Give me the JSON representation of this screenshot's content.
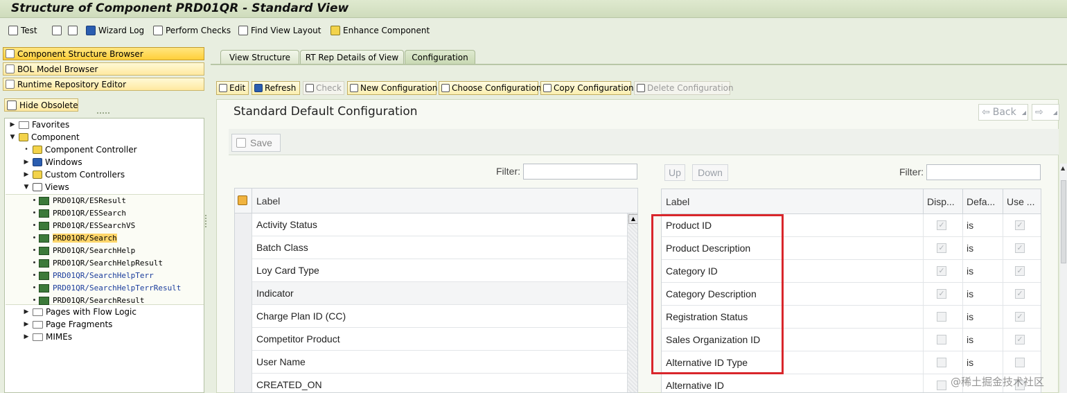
{
  "title": "Structure of Component PRD01QR - Standard View",
  "app_toolbar": {
    "test": "Test",
    "wizard_log": "Wizard Log",
    "perform_checks": "Perform Checks",
    "find_view_layout": "Find View Layout",
    "enhance_component": "Enhance Component"
  },
  "left": {
    "nav_buttons": [
      "Component Structure Browser",
      "BOL Model Browser",
      "Runtime Repository Editor"
    ],
    "hide_obsolete": "Hide Obsolete",
    "tree": {
      "favorites": "Favorites",
      "component": "Component",
      "component_controller": "Component Controller",
      "windows": "Windows",
      "custom_controllers": "Custom Controllers",
      "views": "Views",
      "view_items": [
        "PRD01QR/ESResult",
        "PRD01QR/ESSearch",
        "PRD01QR/ESSearchVS",
        "PRD01QR/Search",
        "PRD01QR/SearchHelp",
        "PRD01QR/SearchHelpResult",
        "PRD01QR/SearchHelpTerr",
        "PRD01QR/SearchHelpTerrResult",
        "PRD01QR/SearchResult"
      ],
      "pages_with_flow_logic": "Pages with Flow Logic",
      "page_fragments": "Page Fragments",
      "mimes": "MIMEs"
    }
  },
  "tabs": [
    "View Structure",
    "RT Rep Details of View",
    "Configuration"
  ],
  "config_toolbar": [
    "Edit",
    "Refresh",
    "Check",
    "New Configuration",
    "Choose Configuration",
    "Copy Configuration",
    "Delete Configuration"
  ],
  "config": {
    "title": "Standard Default Configuration",
    "back": "Back",
    "save": "Save",
    "filter_label": "Filter:",
    "up": "Up",
    "down": "Down",
    "left_table": {
      "header": "Label",
      "rows": [
        "Activity Status",
        "Batch Class",
        "Loy Card Type",
        "Indicator",
        "Charge Plan ID (CC)",
        "Competitor Product",
        "User Name",
        "CREATED_ON"
      ]
    },
    "right_table": {
      "headers": [
        "Label",
        "Disp...",
        "Defa...",
        "Use ..."
      ],
      "rows": [
        {
          "label": "Product ID",
          "disp": true,
          "def": "is",
          "use": true
        },
        {
          "label": "Product Description",
          "disp": true,
          "def": "is",
          "use": true
        },
        {
          "label": "Category ID",
          "disp": true,
          "def": "is",
          "use": true
        },
        {
          "label": "Category Description",
          "disp": true,
          "def": "is",
          "use": true
        },
        {
          "label": "Registration Status",
          "disp": false,
          "def": "is",
          "use": true
        },
        {
          "label": "Sales Organization ID",
          "disp": false,
          "def": "is",
          "use": true
        },
        {
          "label": "Alternative ID Type",
          "disp": false,
          "def": "is",
          "use": false
        },
        {
          "label": "Alternative ID",
          "disp": false,
          "def": "",
          "use": false
        }
      ]
    }
  },
  "watermark": "@稀土掘金技术社区",
  "colors": {
    "highlight": "#d9262b",
    "selection": "#ffd66b",
    "tab_active": "#c9d9b4"
  }
}
